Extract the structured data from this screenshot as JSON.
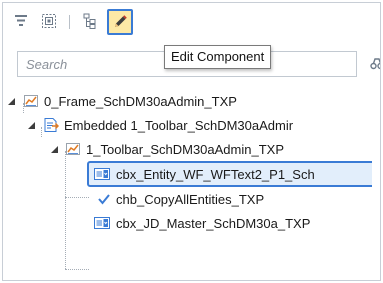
{
  "toolbar": {
    "buttons": [
      {
        "name": "filter",
        "icon": "filter-icon"
      },
      {
        "name": "target",
        "icon": "target-icon"
      },
      {
        "name": "hierarchy",
        "icon": "hierarchy-icon"
      },
      {
        "name": "edit",
        "icon": "pencil-icon",
        "active": true
      }
    ]
  },
  "tooltip": {
    "text": "Edit Component"
  },
  "search": {
    "placeholder": "Search",
    "value": ""
  },
  "tree": {
    "nodes": [
      {
        "label": "0_Frame_SchDM30aAdmin_TXP",
        "icon": "chart-icon",
        "expanded": true
      },
      {
        "label": "Embedded 1_Toolbar_SchDM30aAdmir",
        "icon": "embedded-icon",
        "expanded": true
      },
      {
        "label": "1_Toolbar_SchDM30aAdmin_TXP",
        "icon": "chart-icon",
        "expanded": true
      },
      {
        "label": "cbx_Entity_WF_WFText2_P1_Sch",
        "icon": "combobox-icon",
        "selected": true
      },
      {
        "label": "chb_CopyAllEntities_TXP",
        "icon": "checkbox-icon"
      },
      {
        "label": "cbx_JD_Master_SchDM30a_TXP",
        "icon": "combobox-icon"
      }
    ]
  },
  "colors": {
    "accent": "#3a7bd5",
    "active_button_bg": "#fde9a6",
    "selected_row_bg": "#e2eefb"
  }
}
